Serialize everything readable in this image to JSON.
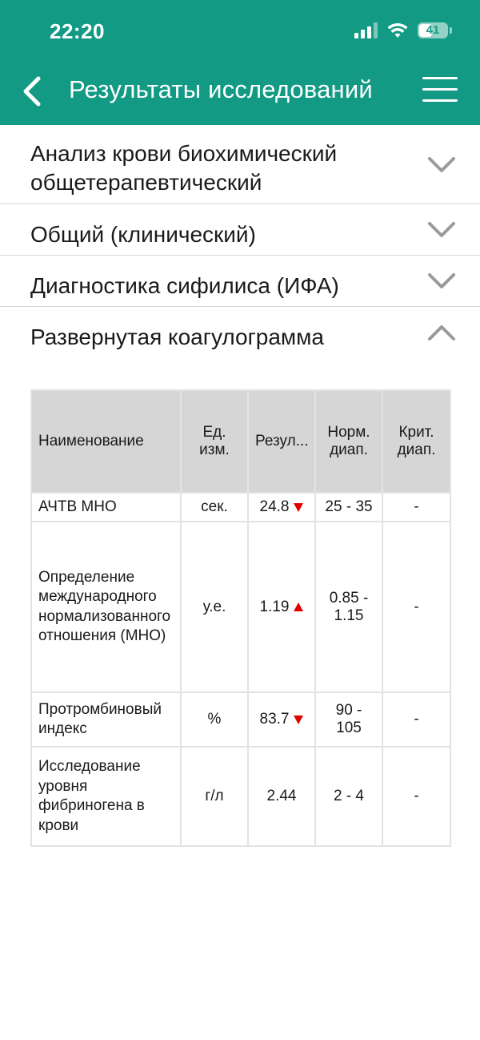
{
  "status_bar": {
    "time": "22:20",
    "battery": "41",
    "icons": [
      "signal-icon",
      "wifi-icon",
      "battery-icon"
    ]
  },
  "header": {
    "title": "Результаты исследований",
    "back_icon": "chevron-left-icon",
    "menu_icon": "hamburger-menu-icon",
    "background": "#129a84"
  },
  "sections": [
    {
      "title": "Анализ крови биохимический общетерапевтический",
      "expanded": false,
      "icon": "chevron-down-icon"
    },
    {
      "title": "Общий (клинический)",
      "expanded": false,
      "icon": "chevron-down-icon"
    },
    {
      "title": "Диагностика сифилиса (ИФА)",
      "expanded": false,
      "icon": "chevron-down-icon"
    },
    {
      "title": "Развернутая коагулограмма",
      "expanded": true,
      "icon": "chevron-up-icon"
    }
  ],
  "table": {
    "headers": {
      "name": "Наименование",
      "unit": "Ед. изм.",
      "result": "Резул...",
      "norm": "Норм. диап.",
      "crit": "Крит. диап."
    },
    "rows": [
      {
        "name": "АЧТВ МНО",
        "unit": "сек.",
        "result": "24.8",
        "flag": "down",
        "norm": "25 - 35",
        "crit": "-"
      },
      {
        "name": "Определение международного нормализованного отношения (МНО)",
        "unit": "у.е.",
        "result": "1.19",
        "flag": "up",
        "norm": "0.85 - 1.15",
        "crit": "-"
      },
      {
        "name": "Протромбиновый индекс",
        "unit": "%",
        "result": "83.7",
        "flag": "down",
        "norm": "90 - 105",
        "crit": "-"
      },
      {
        "name": "Исследование уровня фибриногена в крови",
        "unit": "г/л",
        "result": "2.44",
        "flag": "none",
        "norm": "2 - 4",
        "crit": "-"
      }
    ],
    "flag_color": "#e00000"
  }
}
